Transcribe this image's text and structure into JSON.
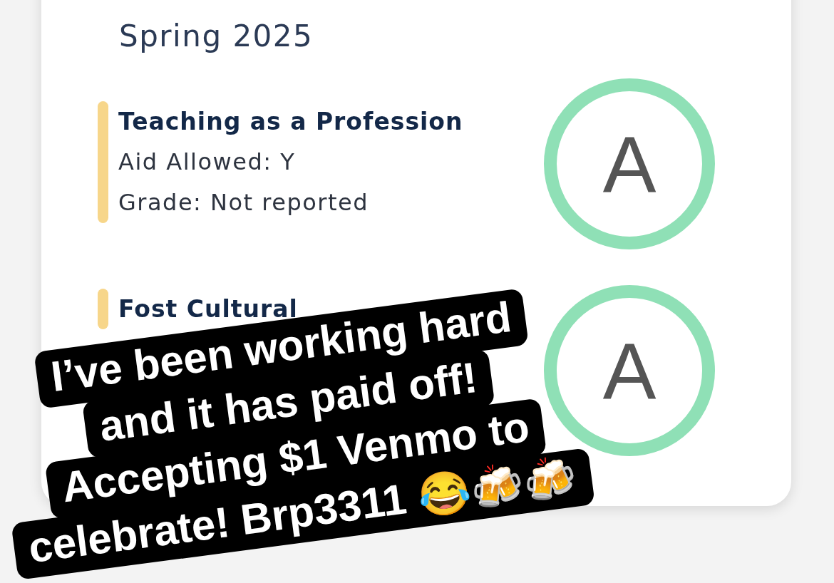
{
  "term": "Spring 2025",
  "courses": [
    {
      "title": "Teaching as a Profession",
      "details": [
        "Aid Allowed: Y",
        "Grade: Not reported"
      ],
      "grade": "A"
    },
    {
      "title": "Fost Cultural",
      "grade": "A"
    }
  ],
  "caption": {
    "lines": [
      "I’ve been working hard",
      "and it has paid off!",
      "Accepting $1 Venmo to",
      "celebrate! Brp3311 😂🍻🍻"
    ]
  }
}
